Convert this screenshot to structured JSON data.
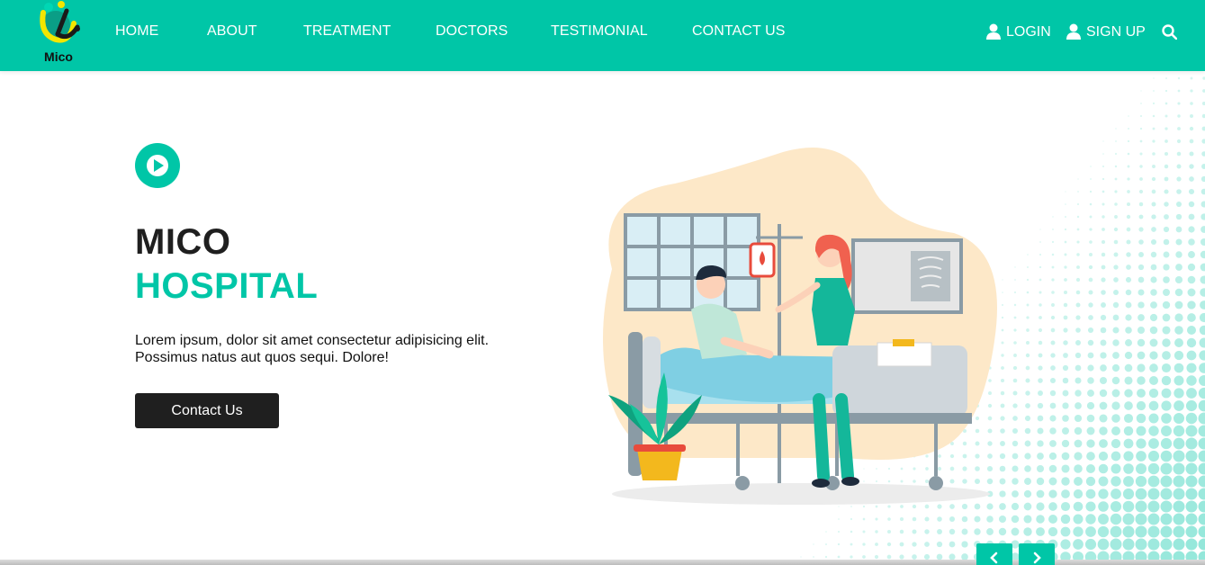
{
  "brand": {
    "name": "Mico",
    "logo_icon": "hospital-logo-icon"
  },
  "nav": {
    "links": [
      "HOME",
      "ABOUT",
      "TREATMENT",
      "DOCTORS",
      "TESTIMONIAL",
      "CONTACT US"
    ],
    "login_label": "LOGIN",
    "signup_label": "SIGN UP",
    "user_icon": "user-icon",
    "search_icon": "search-icon"
  },
  "hero": {
    "play_icon": "play-icon",
    "title_line1": "MICO",
    "title_line2": "HOSPITAL",
    "description": "Lorem ipsum, dolor sit amet consectetur adipisicing elit. Possimus natus aut quos sequi. Dolore!",
    "cta_label": "Contact Us",
    "illustration": "hospital-bed-nurse-illustration"
  },
  "slider": {
    "prev_icon": "chevron-left-icon",
    "next_icon": "chevron-right-icon"
  },
  "colors": {
    "accent": "#00c6a7",
    "dark": "#1f1f1f",
    "white": "#ffffff",
    "skin": "#fde8c8"
  }
}
